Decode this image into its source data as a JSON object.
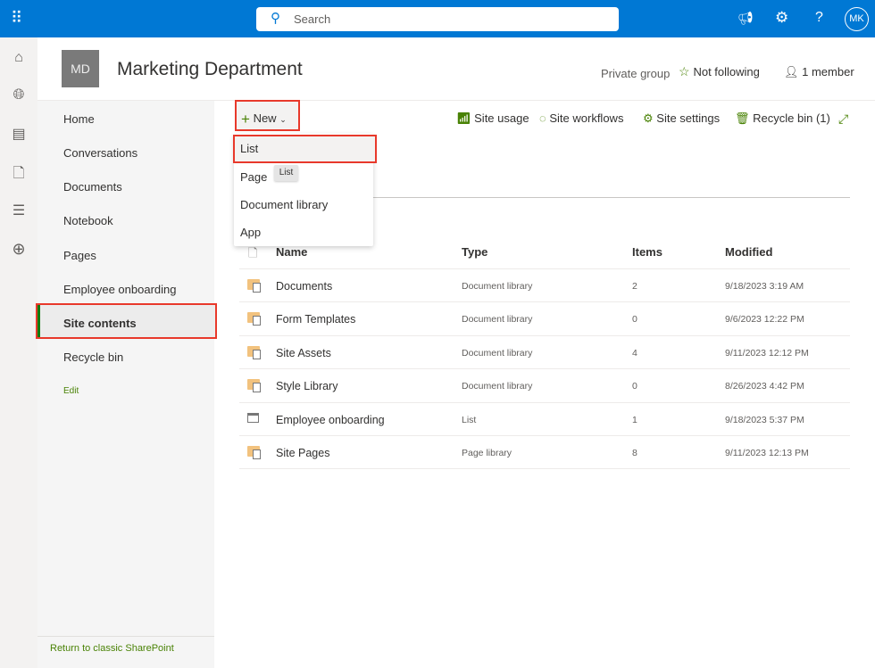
{
  "topbar": {
    "search_placeholder": "Search",
    "avatar": "MK",
    "icons": [
      "app-launcher-icon",
      "search-icon",
      "megaphone-icon",
      "gear-icon",
      "help-icon"
    ]
  },
  "site": {
    "logo": "MD",
    "title": "Marketing Department",
    "privacy": "Private group",
    "follow": "Not following",
    "members": "1 member"
  },
  "nav": {
    "items": [
      "Home",
      "Conversations",
      "Documents",
      "Notebook",
      "Pages",
      "Employee onboarding",
      "Site contents",
      "Recycle bin"
    ],
    "selected": "Site contents",
    "edit": "Edit",
    "classic": "Return to classic SharePoint"
  },
  "commands": {
    "new": "New",
    "site_usage": "Site usage",
    "site_workflows": "Site workflows",
    "site_settings": "Site settings",
    "recycle_bin": "Recycle bin (1)"
  },
  "new_menu": {
    "items": [
      "List",
      "Page",
      "Document library",
      "App"
    ],
    "tooltip": "List"
  },
  "table": {
    "headers": [
      "Name",
      "Type",
      "Items",
      "Modified"
    ],
    "rows": [
      {
        "name": "Documents",
        "type": "Document library",
        "items": "2",
        "modified": "9/18/2023 3:19 AM",
        "icon": "library-icon"
      },
      {
        "name": "Form Templates",
        "type": "Document library",
        "items": "0",
        "modified": "9/6/2023 12:22 PM",
        "icon": "library-icon"
      },
      {
        "name": "Site Assets",
        "type": "Document library",
        "items": "4",
        "modified": "9/11/2023 12:12 PM",
        "icon": "library-icon"
      },
      {
        "name": "Style Library",
        "type": "Document library",
        "items": "0",
        "modified": "8/26/2023 4:42 PM",
        "icon": "library-icon"
      },
      {
        "name": "Employee onboarding",
        "type": "List",
        "items": "1",
        "modified": "9/18/2023 5:37 PM",
        "icon": "list-icon"
      },
      {
        "name": "Site Pages",
        "type": "Page library",
        "items": "8",
        "modified": "9/11/2023 12:13 PM",
        "icon": "library-icon"
      }
    ]
  },
  "colors": {
    "brand": "#0078d4",
    "accent": "#498205",
    "highlight": "#e8392b"
  }
}
